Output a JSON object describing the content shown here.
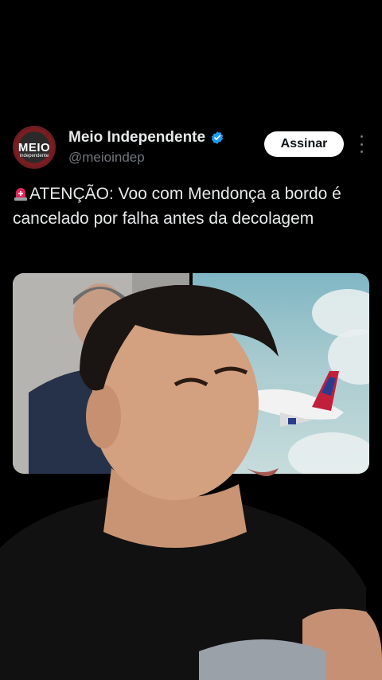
{
  "account": {
    "name": "Meio Independente",
    "handle": "@meioindep",
    "avatar_main": "MEIO",
    "avatar_sub": "independente",
    "verified": true,
    "verified_color": "#1d9bf0"
  },
  "actions": {
    "follow_label": "Assinar"
  },
  "tweet": {
    "text": "ATENÇÃO: Voo com Mendonça a bordo é cancelado por falha antes da decolagem",
    "emoji": "siren-icon"
  },
  "media": {
    "count": 2,
    "items": [
      "photo-man-in-suit",
      "photo-airplane"
    ]
  }
}
